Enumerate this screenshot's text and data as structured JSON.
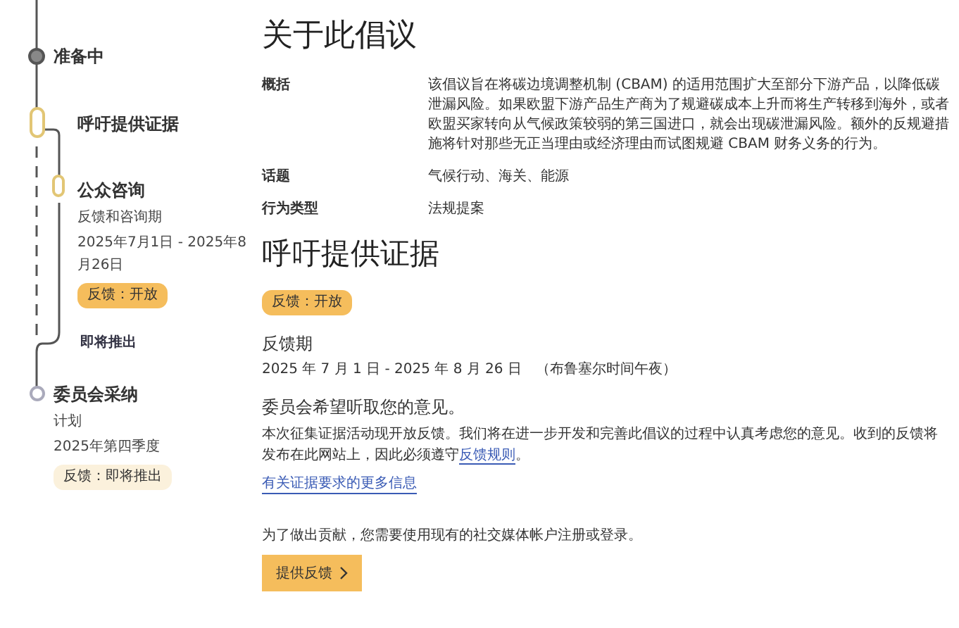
{
  "timeline": [
    {
      "kind": "done",
      "title": "准备中"
    },
    {
      "kind": "current",
      "title": "呼吁提供证据"
    },
    {
      "kind": "sub_current",
      "title": "公众咨询",
      "subtitle": "反馈和咨询期",
      "dates": "2025年7月1日 - 2025年8月26日",
      "badge": {
        "text": "反馈：开放",
        "kind": "open"
      }
    },
    {
      "kind": "sub_upcoming",
      "title": "即将推出"
    },
    {
      "kind": "upcoming",
      "title": "委员会采纳",
      "subtitle": "计划",
      "dates": "2025年第四季度",
      "badge": {
        "text": "反馈：即将推出",
        "kind": "upcoming"
      }
    }
  ],
  "about": {
    "title": "关于此倡议",
    "details": [
      {
        "label": "概括",
        "value": "该倡议旨在将碳边境调整机制 (CBAM) 的适用范围扩大至部分下游产品，以降低碳泄漏风险。如果欧盟下游产品生产商为了规避碳成本上升而将生产转移到海外，或者欧盟买家转向从气候政策较弱的第三国进口，就会出现碳泄漏风险。额外的反规避措施将针对那些无正当理由或经济理由而试图规避 CBAM 财务义务的行为。"
      },
      {
        "label": "话题",
        "value": "气候行动、海关、能源"
      },
      {
        "label": "行为类型",
        "value": "法规提案"
      }
    ]
  },
  "call": {
    "title": "呼吁提供证据",
    "badge": {
      "text": "反馈：开放",
      "kind": "open"
    },
    "period_label": "反馈期",
    "period": "2025 年 7 月 1 日 - 2025 年 8 月 26 日",
    "period_note": "（布鲁塞尔时间午夜）",
    "heading": "委员会希望听取您的意见。",
    "paragraph_before": "本次征集证据活动现开放反馈。我们将在进一步开发和完善此倡议的过程中认真考虑您的意见。收到的反馈将发布在此网站上，因此必须遵守",
    "paragraph_link": "反馈规则",
    "paragraph_after": "。",
    "more_link": "有关证据要求的更多信息",
    "login_note": "为了做出贡献，您需要使用现有的社交媒体帐户注册或登录。",
    "button": "提供反馈"
  }
}
